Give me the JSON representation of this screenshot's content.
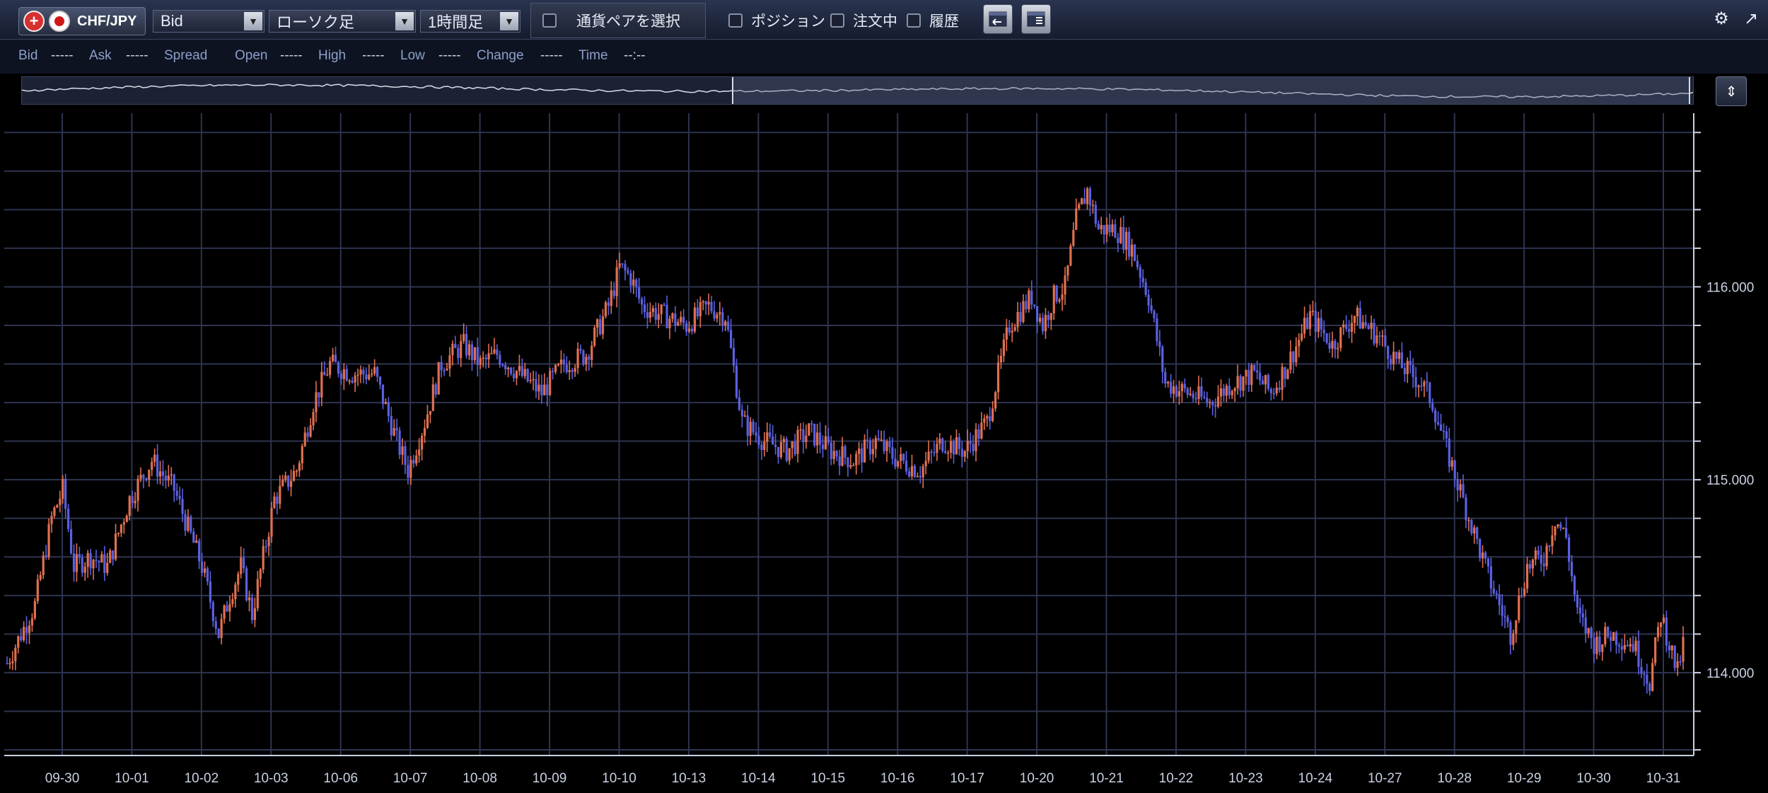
{
  "toolbar": {
    "pair": "CHF/JPY",
    "price_type": "Bid",
    "chart_type": "ローソク足",
    "timeframe": "1時間足",
    "pair_select_label": "通貨ペアを選択",
    "position_label": "ポジション",
    "order_label": "注文中",
    "history_label": "履歴"
  },
  "info": {
    "bid_label": "Bid",
    "bid_value": "-----",
    "ask_label": "Ask",
    "ask_value": "-----",
    "spread_label": "Spread",
    "open_label": "Open",
    "open_value": "-----",
    "high_label": "High",
    "high_value": "-----",
    "low_label": "Low",
    "low_value": "-----",
    "change_label": "Change",
    "change_value": "-----",
    "time_label": "Time",
    "time_value": "--:--"
  },
  "colors": {
    "up": "#e07050",
    "down": "#5a60e0",
    "grid": "#2e3450",
    "axis_text": "#c9d2e3",
    "background": "#000000"
  },
  "chart_data": {
    "type": "candlestick",
    "x_ticks": [
      "09-30",
      "10-01",
      "10-02",
      "10-03",
      "10-06",
      "10-07",
      "10-08",
      "10-09",
      "10-10",
      "10-13",
      "10-14",
      "10-15",
      "10-16",
      "10-17",
      "10-20",
      "10-21",
      "10-22",
      "10-23",
      "10-24",
      "10-27",
      "10-28",
      "10-29",
      "10-30",
      "10-31"
    ],
    "y_ticks": [
      114.0,
      115.0,
      116.0
    ],
    "y_tick_labels": [
      "114.000",
      "115.000",
      "116.000"
    ],
    "ylim": [
      113.6,
      116.9
    ],
    "close_path": [
      [
        0,
        114.05
      ],
      [
        5,
        114.35
      ],
      [
        8,
        114.8
      ],
      [
        10,
        114.95
      ],
      [
        12,
        114.55
      ],
      [
        15,
        114.6
      ],
      [
        18,
        114.55
      ],
      [
        22,
        114.9
      ],
      [
        26,
        115.1
      ],
      [
        30,
        114.95
      ],
      [
        35,
        114.55
      ],
      [
        38,
        114.2
      ],
      [
        40,
        114.4
      ],
      [
        42,
        114.55
      ],
      [
        44,
        114.3
      ],
      [
        46,
        114.6
      ],
      [
        48,
        114.9
      ],
      [
        52,
        115.05
      ],
      [
        55,
        115.4
      ],
      [
        58,
        115.6
      ],
      [
        62,
        115.55
      ],
      [
        66,
        115.55
      ],
      [
        70,
        115.2
      ],
      [
        72,
        115.05
      ],
      [
        75,
        115.3
      ],
      [
        78,
        115.6
      ],
      [
        82,
        115.7
      ],
      [
        85,
        115.6
      ],
      [
        88,
        115.65
      ],
      [
        92,
        115.55
      ],
      [
        96,
        115.45
      ],
      [
        100,
        115.6
      ],
      [
        104,
        115.65
      ],
      [
        108,
        115.9
      ],
      [
        110,
        116.1
      ],
      [
        112,
        116.05
      ],
      [
        114,
        115.9
      ],
      [
        118,
        115.85
      ],
      [
        122,
        115.8
      ],
      [
        126,
        115.9
      ],
      [
        129,
        115.85
      ],
      [
        132,
        115.3
      ],
      [
        134,
        115.25
      ],
      [
        136,
        115.2
      ],
      [
        140,
        115.15
      ],
      [
        144,
        115.25
      ],
      [
        148,
        115.15
      ],
      [
        152,
        115.1
      ],
      [
        156,
        115.2
      ],
      [
        160,
        115.1
      ],
      [
        164,
        115.05
      ],
      [
        168,
        115.2
      ],
      [
        172,
        115.15
      ],
      [
        176,
        115.3
      ],
      [
        180,
        115.8
      ],
      [
        184,
        115.95
      ],
      [
        186,
        115.8
      ],
      [
        188,
        115.95
      ],
      [
        190,
        116.0
      ],
      [
        192,
        116.35
      ],
      [
        194,
        116.5
      ],
      [
        196,
        116.3
      ],
      [
        199,
        116.3
      ],
      [
        202,
        116.2
      ],
      [
        205,
        115.95
      ],
      [
        208,
        115.5
      ],
      [
        212,
        115.45
      ],
      [
        216,
        115.4
      ],
      [
        220,
        115.5
      ],
      [
        224,
        115.55
      ],
      [
        227,
        115.45
      ],
      [
        230,
        115.6
      ],
      [
        234,
        115.85
      ],
      [
        238,
        115.7
      ],
      [
        242,
        115.85
      ],
      [
        246,
        115.75
      ],
      [
        250,
        115.6
      ],
      [
        254,
        115.5
      ],
      [
        256,
        115.4
      ],
      [
        258,
        115.2
      ],
      [
        262,
        114.85
      ],
      [
        266,
        114.5
      ],
      [
        270,
        114.2
      ],
      [
        273,
        114.55
      ],
      [
        276,
        114.6
      ],
      [
        278,
        114.8
      ],
      [
        280,
        114.7
      ],
      [
        282,
        114.3
      ],
      [
        285,
        114.15
      ],
      [
        288,
        114.2
      ],
      [
        292,
        114.15
      ],
      [
        295,
        113.95
      ],
      [
        297,
        114.3
      ],
      [
        300,
        114.0
      ],
      [
        301,
        114.15
      ]
    ]
  }
}
